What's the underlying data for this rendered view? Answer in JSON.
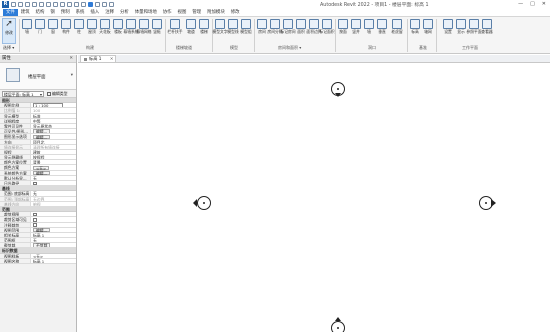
{
  "app": {
    "title": "Autodesk Revit 2022 - 项目1 - 楼层平面: 标高 1"
  },
  "window_controls": [
    "—",
    "□",
    "✕"
  ],
  "ribbon_tabs": [
    {
      "label": "文件",
      "active": true
    },
    {
      "label": "建筑"
    },
    {
      "label": "结构"
    },
    {
      "label": "钢"
    },
    {
      "label": "预制"
    },
    {
      "label": "系统"
    },
    {
      "label": "插入"
    },
    {
      "label": "注释"
    },
    {
      "label": "分析"
    },
    {
      "label": "体量和场地"
    },
    {
      "label": "协作"
    },
    {
      "label": "视图"
    },
    {
      "label": "管理"
    },
    {
      "label": "附加模块"
    },
    {
      "label": "修改"
    }
  ],
  "ribbon": {
    "modify_label": "修改",
    "select_label": "选择 ▾",
    "buttons": [
      {
        "label": "墙",
        "icon": "wall-icon"
      },
      {
        "label": "门",
        "icon": "door-icon"
      },
      {
        "label": "窗",
        "icon": "window-icon"
      },
      {
        "label": "构件",
        "icon": "component-icon"
      },
      {
        "label": "柱",
        "icon": "column-icon"
      },
      {
        "label": "屋顶",
        "icon": "roof-icon"
      },
      {
        "label": "天花板",
        "icon": "ceiling-icon"
      },
      {
        "label": "楼板",
        "icon": "floor-icon"
      },
      {
        "label": "幕墙系统",
        "icon": "curtain-system-icon"
      },
      {
        "label": "幕墙网格",
        "icon": "curtain-grid-icon"
      },
      {
        "label": "竖梃",
        "icon": "mullion-icon"
      },
      {
        "label": "栏杆扶手",
        "icon": "railing-icon"
      },
      {
        "label": "坡道",
        "icon": "ramp-icon"
      },
      {
        "label": "楼梯",
        "icon": "stair-icon"
      },
      {
        "label": "模型文字",
        "icon": "model-text-icon"
      },
      {
        "label": "模型线",
        "icon": "model-line-icon"
      },
      {
        "label": "模型组",
        "icon": "model-group-icon"
      },
      {
        "label": "房间",
        "icon": "room-icon"
      },
      {
        "label": "房间分隔",
        "icon": "room-separator-icon"
      },
      {
        "label": "标记房间",
        "icon": "tag-room-icon"
      },
      {
        "label": "面积",
        "icon": "area-icon"
      },
      {
        "label": "面积边界",
        "icon": "area-boundary-icon"
      },
      {
        "label": "标记面积",
        "icon": "tag-area-icon"
      },
      {
        "label": "按面",
        "icon": "by-face-icon"
      },
      {
        "label": "竖井",
        "icon": "shaft-icon"
      },
      {
        "label": "墙",
        "icon": "wall-opening-icon"
      },
      {
        "label": "垂直",
        "icon": "vertical-icon"
      },
      {
        "label": "老虎窗",
        "icon": "dormer-icon"
      },
      {
        "label": "标高",
        "icon": "level-icon"
      },
      {
        "label": "轴网",
        "icon": "grid-icon"
      },
      {
        "label": "设置",
        "icon": "set-icon"
      },
      {
        "label": "显示",
        "icon": "show-icon"
      },
      {
        "label": "参照平面",
        "icon": "ref-plane-icon"
      },
      {
        "label": "查看器",
        "icon": "viewer-icon"
      }
    ],
    "groups": [
      {
        "label": "构建"
      },
      {
        "label": "楼梯坡道"
      },
      {
        "label": "模型"
      },
      {
        "label": "房间和面积 ▾"
      },
      {
        "label": "洞口"
      },
      {
        "label": "基准"
      },
      {
        "label": "工作平面"
      }
    ]
  },
  "view_tab": {
    "label": "标高 1",
    "close": "✕"
  },
  "properties": {
    "title": "属性",
    "close": "✕",
    "type_name": "楼层平面",
    "instance_selector": "楼层平面: 标高 1",
    "edit_type_label": "编辑类型",
    "sections": [
      {
        "name": "图形",
        "rows": [
          {
            "k": "视图比例",
            "v": "1 : 100",
            "kind": "input"
          },
          {
            "k": "比例值 1:",
            "v": "100",
            "dim": true
          },
          {
            "k": "显示模型",
            "v": "标准"
          },
          {
            "k": "详细程度",
            "v": "中等"
          },
          {
            "k": "零件可见性",
            "v": "显示原状态"
          },
          {
            "k": "可见性/图形...",
            "v": "编辑...",
            "kind": "button"
          },
          {
            "k": "图形显示选项",
            "v": "编辑...",
            "kind": "button"
          },
          {
            "k": "方向",
            "v": "项目北"
          },
          {
            "k": "墙连接显示",
            "v": "清理所有墙连接",
            "dim": true
          },
          {
            "k": "规程",
            "v": "建筑"
          },
          {
            "k": "显示隐藏线",
            "v": "按规程"
          },
          {
            "k": "颜色方案位置",
            "v": "背景"
          },
          {
            "k": "颜色方案",
            "v": "<无>",
            "kind": "button"
          },
          {
            "k": "系统颜色方案",
            "v": "编辑...",
            "kind": "button"
          },
          {
            "k": "默认分析显...",
            "v": "无"
          },
          {
            "k": "日光路径",
            "v": "",
            "kind": "check"
          }
        ]
      },
      {
        "name": "基线",
        "rows": [
          {
            "k": "范围: 底部标高",
            "v": "无"
          },
          {
            "k": "范围: 顶部标高",
            "v": "无边界",
            "dim": true
          },
          {
            "k": "基线方向",
            "v": "俯视",
            "dim": true
          }
        ]
      },
      {
        "name": "范围",
        "rows": [
          {
            "k": "裁剪视图",
            "v": "",
            "kind": "check"
          },
          {
            "k": "裁剪区域可见",
            "v": "",
            "kind": "check"
          },
          {
            "k": "注释裁剪",
            "v": "",
            "kind": "check"
          },
          {
            "k": "视图范围",
            "v": "编辑...",
            "kind": "button"
          },
          {
            "k": "相关标高",
            "v": "标高 1"
          },
          {
            "k": "范围框",
            "v": "无"
          },
          {
            "k": "截剪裁",
            "v": "不剪裁",
            "kind": "button"
          }
        ]
      },
      {
        "name": "标识数据",
        "rows": [
          {
            "k": "视图样板",
            "v": "<无>"
          },
          {
            "k": "视图名称",
            "v": "标高 1"
          }
        ]
      }
    ]
  }
}
